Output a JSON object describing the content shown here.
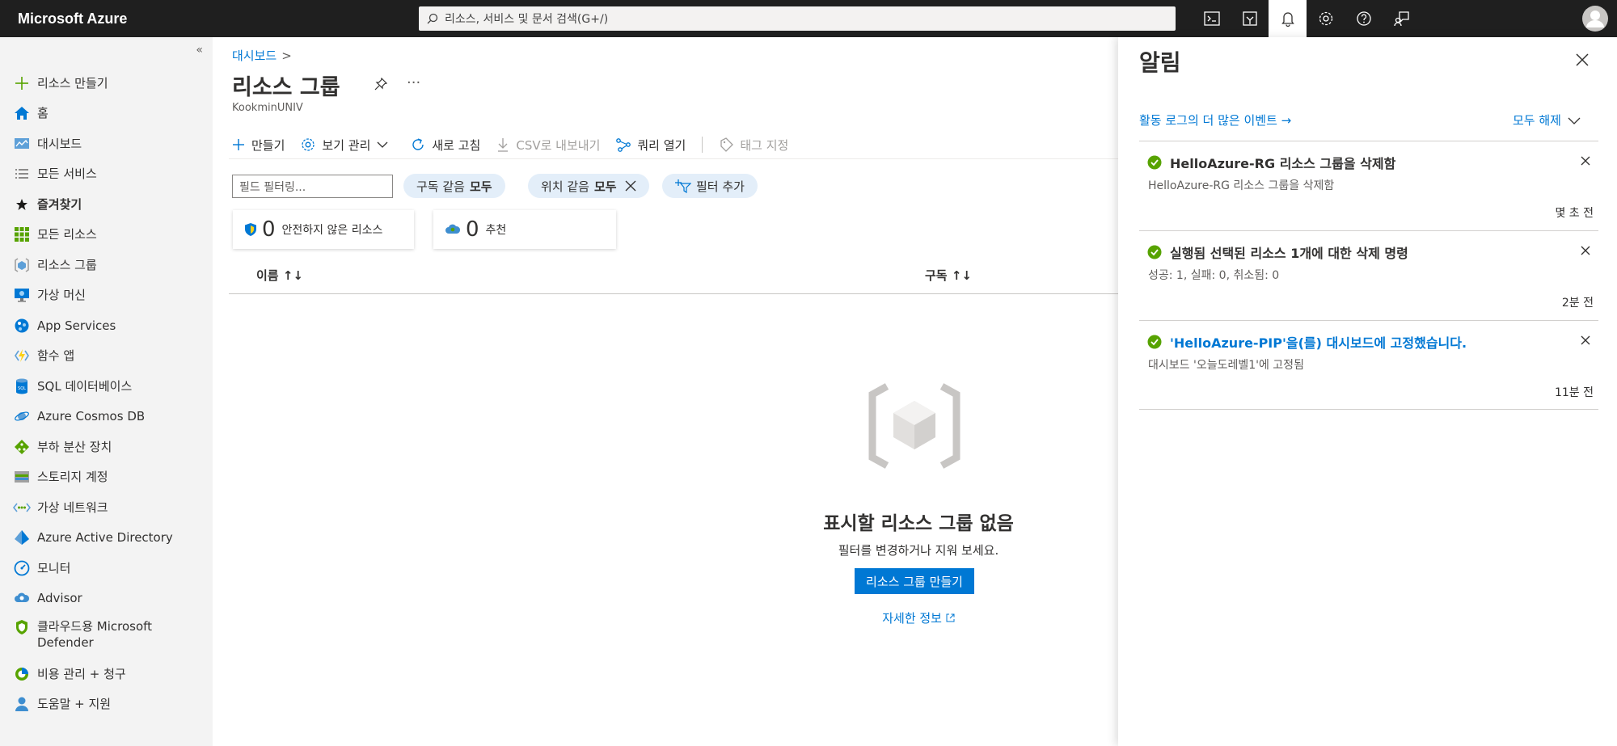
{
  "topbar": {
    "brand": "Microsoft Azure",
    "search_placeholder": "리소스, 서비스 및 문서 검색(G+/)",
    "icons": [
      "cloud-shell-icon",
      "directory-filter-icon",
      "notifications-bell-icon",
      "settings-gear-icon",
      "help-icon",
      "feedback-icon"
    ]
  },
  "sidebar": {
    "collapse": "«",
    "items": [
      {
        "label": "리소스 만들기",
        "icon": "plus-icon"
      },
      {
        "label": "홈",
        "icon": "home-icon"
      },
      {
        "label": "대시보드",
        "icon": "dashboard-icon"
      },
      {
        "label": "모든 서비스",
        "icon": "list-icon"
      },
      {
        "label": "즐겨찾기",
        "icon": "star-icon"
      },
      {
        "label": "모든 리소스",
        "icon": "grid-icon"
      },
      {
        "label": "리소스 그룹",
        "icon": "resource-group-icon"
      },
      {
        "label": "가상 머신",
        "icon": "virtual-machine-icon"
      },
      {
        "label": "App Services",
        "icon": "app-services-icon"
      },
      {
        "label": "함수 앱",
        "icon": "function-app-icon"
      },
      {
        "label": "SQL 데이터베이스",
        "icon": "sql-database-icon"
      },
      {
        "label": "Azure Cosmos DB",
        "icon": "cosmos-db-icon"
      },
      {
        "label": "부하 분산 장치",
        "icon": "load-balancer-icon"
      },
      {
        "label": "스토리지 계정",
        "icon": "storage-account-icon"
      },
      {
        "label": "가상 네트워크",
        "icon": "virtual-network-icon"
      },
      {
        "label": "Azure Active Directory",
        "icon": "active-directory-icon"
      },
      {
        "label": "모니터",
        "icon": "monitor-icon"
      },
      {
        "label": "Advisor",
        "icon": "advisor-icon"
      },
      {
        "label": "클라우드용 Microsoft",
        "label2": "Defender",
        "icon": "defender-icon"
      },
      {
        "label": "비용 관리 + 청구",
        "icon": "cost-management-icon"
      },
      {
        "label": "도움말 + 지원",
        "icon": "help-support-icon"
      }
    ]
  },
  "main": {
    "breadcrumb": "대시보드",
    "breadcrumb_sep": ">",
    "title": "리소스 그룹",
    "more": "···",
    "subtitle": "KookminUNIV",
    "commands": {
      "create": "만들기",
      "manage_view": "보기 관리",
      "refresh": "새로 고침",
      "export_csv": "CSV로 내보내기",
      "open_query": "쿼리 열기",
      "assign_tags": "태그 지정"
    },
    "filter_placeholder": "필드 필터링...",
    "pills": {
      "subscription": {
        "prefix": "구독 같음",
        "value": "모두"
      },
      "location": {
        "prefix": "위치 같음",
        "value": "모두"
      },
      "add_filter": "필터 추가"
    },
    "cards": {
      "insecure": {
        "count": "0",
        "label": "안전하지 않은 리소스"
      },
      "recommend": {
        "count": "0",
        "label": "추천"
      }
    },
    "columns": {
      "name": "이름 ↑↓",
      "subscription": "구독 ↑↓"
    },
    "empty": {
      "title": "표시할 리소스 그룹 없음",
      "subtitle": "필터를 변경하거나 지워 보세요.",
      "button": "리소스 그룹 만들기",
      "learn_more": "자세한 정보"
    }
  },
  "notifications": {
    "title": "알림",
    "activity_link": "활동 로그의 더 많은 이벤트 →",
    "dismiss_all": "모두 해제",
    "items": [
      {
        "title": "HelloAzure-RG 리소스 그룹을 삭제함",
        "body": "HelloAzure-RG 리소스 그룹을 삭제함",
        "time": "몇 초 전",
        "link": false
      },
      {
        "title": "실행됨 선택된 리소스 1개에 대한 삭제 명령",
        "body": "성공: 1, 실패: 0, 취소됨: 0",
        "time": "2분 전",
        "link": false
      },
      {
        "title": "'HelloAzure-PIP'을(를) 대시보드에 고정했습니다.",
        "body": "대시보드 '오늘도레벨1'에 고정됨",
        "time": "11분 전",
        "link": true
      }
    ]
  },
  "colors": {
    "accent": "#0078d4",
    "topbar": "#1f1f1f",
    "sidebar": "#f3f3f3",
    "success": "#57a300"
  }
}
